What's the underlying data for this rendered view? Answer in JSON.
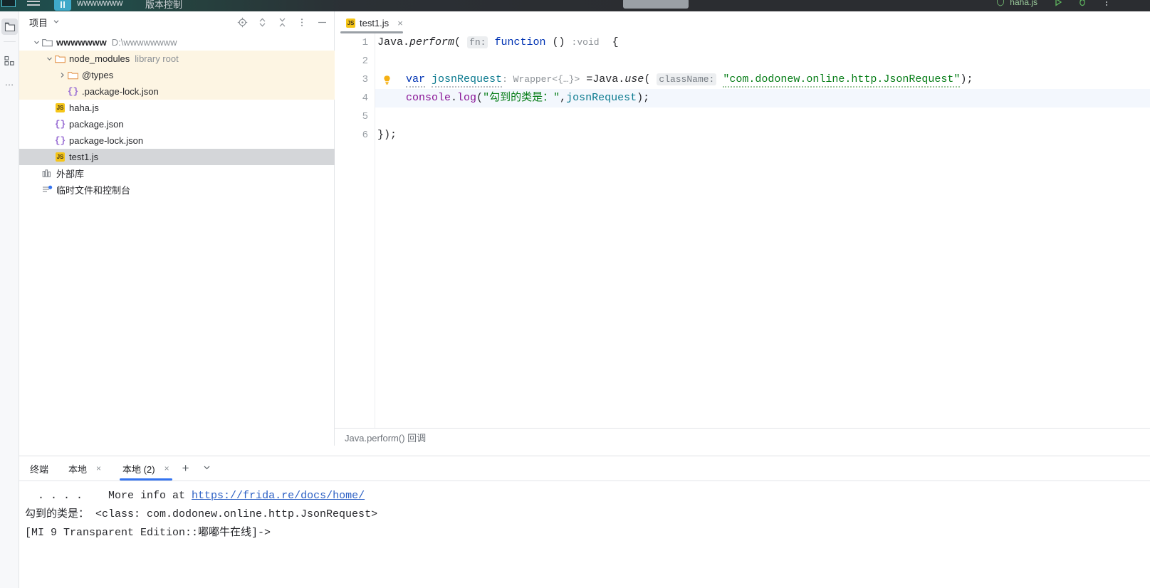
{
  "titlebar": {
    "project_name": "wwwwwww",
    "vcs_label": "版本控制",
    "run_config": "haha.js",
    "icons": {
      "menu": "hamburger-icon",
      "run": "run-icon",
      "debug": "debug-icon",
      "more": "more-vertical-icon"
    }
  },
  "rail": {
    "project_tooltip": "项目",
    "structure_tooltip": "结构",
    "more_label": "…"
  },
  "project_panel": {
    "title": "项目",
    "tools": [
      "locate-icon",
      "expand-collapse-icon",
      "collapse-all-icon",
      "options-icon",
      "hide-icon"
    ],
    "tree": [
      {
        "label": "wwwwwww",
        "sub": "D:\\wwwwwwww",
        "indent": 0,
        "arrow": "down",
        "icon": "folder-icon",
        "bold": true,
        "state": "normal"
      },
      {
        "label": "node_modules",
        "sub": "library root",
        "indent": 1,
        "arrow": "down",
        "icon": "folder-orange-icon",
        "bold": false,
        "state": "library"
      },
      {
        "label": "@types",
        "sub": "",
        "indent": 2,
        "arrow": "right",
        "icon": "folder-orange-icon",
        "bold": false,
        "state": "library"
      },
      {
        "label": ".package-lock.json",
        "sub": "",
        "indent": 2,
        "arrow": "none",
        "icon": "json-icon",
        "bold": false,
        "state": "library"
      },
      {
        "label": "haha.js",
        "sub": "",
        "indent": 1,
        "arrow": "none",
        "icon": "js-icon",
        "bold": false,
        "state": "normal"
      },
      {
        "label": "package.json",
        "sub": "",
        "indent": 1,
        "arrow": "none",
        "icon": "json-icon",
        "bold": false,
        "state": "normal"
      },
      {
        "label": "package-lock.json",
        "sub": "",
        "indent": 1,
        "arrow": "none",
        "icon": "json-icon",
        "bold": false,
        "state": "normal"
      },
      {
        "label": "test1.js",
        "sub": "",
        "indent": 1,
        "arrow": "none",
        "icon": "js-icon",
        "bold": false,
        "state": "selected"
      },
      {
        "label": "外部库",
        "sub": "",
        "indent": 0,
        "arrow": "none",
        "icon": "library-icon",
        "bold": false,
        "state": "normal"
      },
      {
        "label": "临时文件和控制台",
        "sub": "",
        "indent": 0,
        "arrow": "none",
        "icon": "scratches-icon",
        "bold": false,
        "state": "normal"
      }
    ]
  },
  "editor": {
    "tab": {
      "name": "test1.js",
      "close": "×",
      "icon": "js-icon"
    },
    "line_numbers": [
      "1",
      "2",
      "3",
      "4",
      "5",
      "6"
    ],
    "breadcrumb": "Java.perform() 回调",
    "code": {
      "l1_java": "Java.",
      "l1_perform": "perform",
      "l1_paren": "(",
      "l1_hint_fn": "fn:",
      "l1_function": "function",
      "l1_args": "()",
      "l1_colon": ":",
      "l1_void": "void",
      "l1_brace": "{",
      "l3_var": "var",
      "l3_name": "josnRequest",
      "l3_type": ": Wrapper<{…}>",
      "l3_eq": " =Java.",
      "l3_use": "use",
      "l3_paren": "(",
      "l3_hint_class": "className:",
      "l3_string": "\"com.dodonew.online.http.JsonRequest\"",
      "l3_tail": ");",
      "l4_console": "console",
      "l4_dot": ".",
      "l4_log": "log",
      "l4_open": "(",
      "l4_string": "\"勾到的类是：\"",
      "l4_comma": ",",
      "l4_arg": "josnRequest",
      "l4_close": ");",
      "l6_end": "});"
    }
  },
  "terminal": {
    "header_label": "终端",
    "tabs": [
      {
        "label": "本地",
        "close": "×",
        "active": false
      },
      {
        "label": "本地 (2)",
        "close": "×",
        "active": true
      }
    ],
    "add_label": "+",
    "chevron": "⌄",
    "output": {
      "line1_prefix": "  . . . .    More info at ",
      "line1_link": "https://frida.re/docs/home/",
      "line2": "勾到的类是： <class: com.dodonew.online.http.JsonRequest>",
      "line3": "[MI 9 Transparent Edition::嘟嘟牛在线]->"
    }
  }
}
